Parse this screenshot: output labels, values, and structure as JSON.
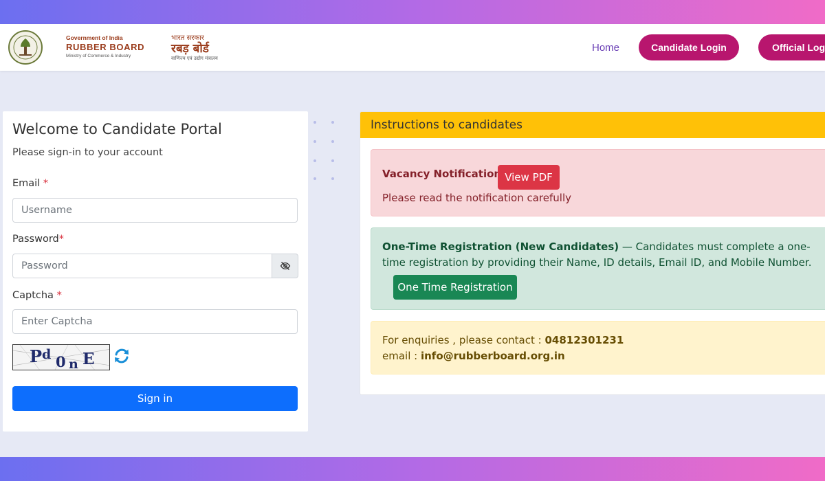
{
  "header": {
    "brand_en": {
      "gov": "Government of India",
      "name": "RUBBER BOARD",
      "ministry": "Ministry of Commerce & Industry"
    },
    "brand_hi": {
      "gov": "भारत सरकार",
      "name": "रबड़ बोर्ड",
      "ministry": "वाणिज्य एवं उद्योग मंत्रालय"
    },
    "nav": {
      "home": "Home",
      "candidate_login": "Candidate Login",
      "official_login": "Official Login"
    }
  },
  "login": {
    "title": "Welcome to Candidate Portal",
    "subtitle": "Please sign-in to your account",
    "email_label": "Email",
    "email_placeholder": "Username",
    "password_label": "Password",
    "password_placeholder": "Password",
    "captcha_label": "Captcha",
    "captcha_placeholder": "Enter Captcha",
    "required_mark": "*",
    "captcha_chars": [
      "P",
      "d",
      "0",
      "n",
      "E"
    ],
    "signin_label": "Sign in"
  },
  "instructions": {
    "header": "Instructions to candidates",
    "vacancy": {
      "title": "Vacancy Notification",
      "button": "View PDF",
      "note": "Please read the notification carefully"
    },
    "registration": {
      "title": "One-Time Registration (New Candidates)",
      "text": " — Candidates must complete a one-time registration by providing their Name, ID details, Email ID, and Mobile Number.",
      "button": "One Time Registration"
    },
    "enquiry": {
      "contact_prefix": "For enquiries , please contact : ",
      "phone": "04812301231",
      "email_prefix": "email : ",
      "email": "info@rubberboard.org.in"
    }
  },
  "colors": {
    "nav_pill": "#b8166e",
    "signin": "#0d6efd",
    "instr_header": "#ffc107",
    "danger": "#dc3545",
    "success": "#198754"
  }
}
